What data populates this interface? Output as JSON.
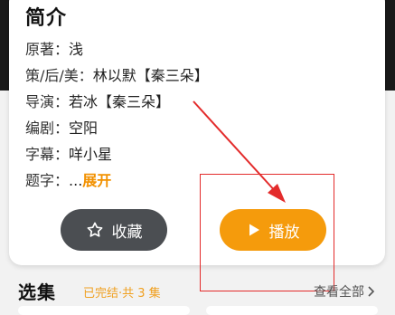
{
  "intro": {
    "title": "简介",
    "rows": [
      {
        "label": "原著：",
        "value": "浅"
      },
      {
        "label": "策/后/美：",
        "value": "林以默【秦三朵】"
      },
      {
        "label": "导演：",
        "value": "若冰【秦三朵】"
      },
      {
        "label": "编剧：",
        "value": "空阳"
      },
      {
        "label": "字幕：",
        "value": "咩小星"
      },
      {
        "label": "题字：",
        "value": "...",
        "expand": "展开"
      }
    ]
  },
  "actions": {
    "favorite_label": "收藏",
    "favorite_icon": "star-outline-icon",
    "play_label": "播放",
    "play_icon": "play-triangle-icon"
  },
  "episodes": {
    "title": "选集",
    "status": "已完结·共 3 集",
    "view_all": "查看全部"
  },
  "colors": {
    "accent": "#f59b0c",
    "favorite_bg": "#4b4e52",
    "annotation": "#e32b2b"
  }
}
